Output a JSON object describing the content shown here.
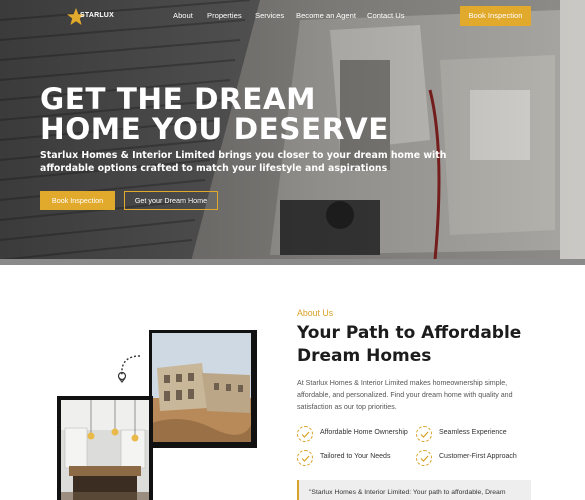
{
  "header": {
    "logo_text": "STARLUX",
    "nav": [
      "About",
      "Properties",
      "Services",
      "Become an Agent",
      "Contact Us"
    ],
    "cta_label": "Book Inspection"
  },
  "hero": {
    "title_line1": "GET THE DREAM",
    "title_line2": "HOME YOU DESERVE",
    "subtitle": "Starlux Homes & Interior Limited brings you closer to your dream home with affordable options crafted to match your lifestyle and aspirations",
    "primary_button": "Book Inspection",
    "secondary_button": "Get your Dream Home"
  },
  "about": {
    "label": "About Us",
    "title": "Your Path to Affordable Dream Homes",
    "text": "At Starlux Homes & Interior Limited makes homeownership simple, affordable, and personalized. Find your dream home with quality and satisfaction as our top priorities.",
    "features": [
      "Affordable Home Ownership",
      "Seamless Experience",
      "Tailored to Your Needs",
      "Customer-First Approach"
    ],
    "quote": "\"Starlux Homes & Interior Limited: Your path to affordable, Dream"
  },
  "colors": {
    "accent": "#e2aa2d",
    "dark_text": "#1c1c1c",
    "body_text": "#555555"
  },
  "icons": [
    "star-logo-icon",
    "check-circle-icon",
    "curved-arrow-icon"
  ]
}
